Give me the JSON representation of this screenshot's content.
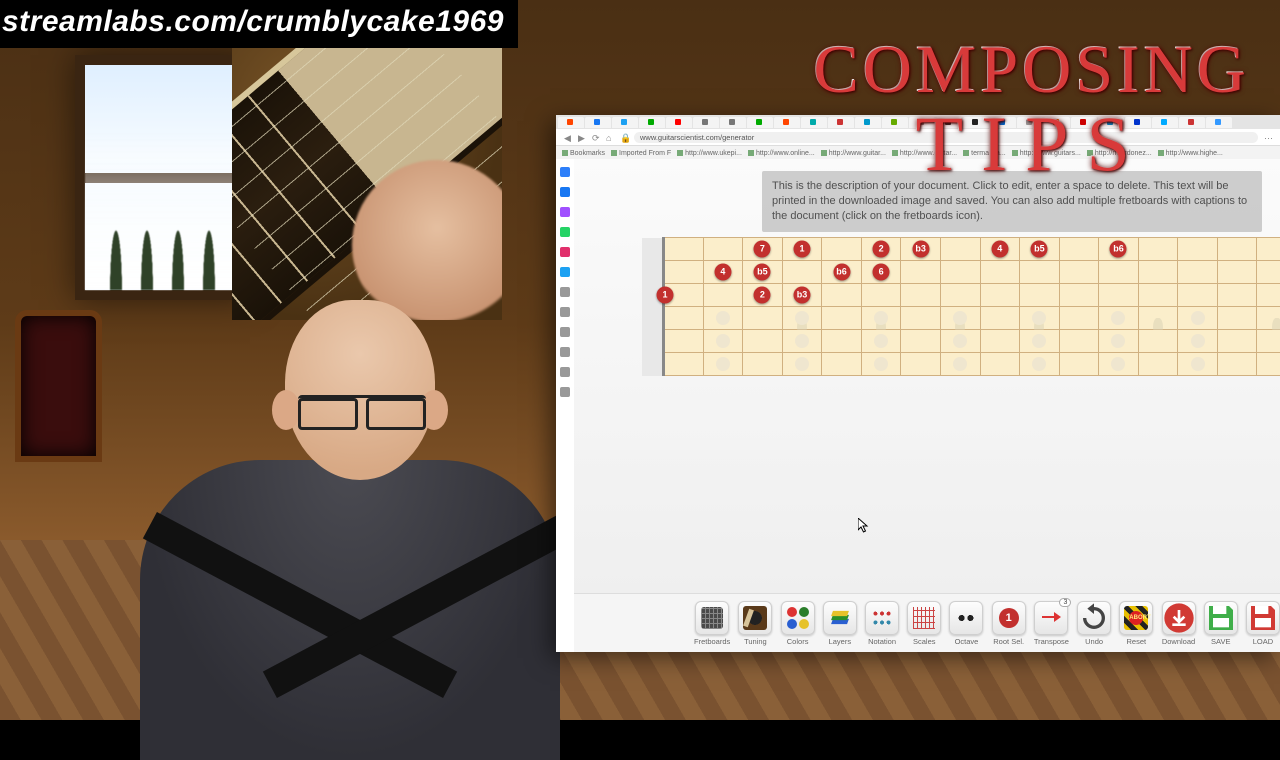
{
  "watermark": "streamlabs.com/crumblycake1969",
  "title": {
    "line1": "COMPOSING",
    "line2": "TIPS"
  },
  "browser": {
    "url": "www.guitarscientist.com/generator",
    "url_lock_icon": "lock-icon",
    "tabs": [
      {
        "fav": "#ff4500"
      },
      {
        "fav": "#1877f2"
      },
      {
        "fav": "#1da1f2"
      },
      {
        "fav": "#0a0"
      },
      {
        "fav": "#ff0000"
      },
      {
        "fav": "#777"
      },
      {
        "fav": "#777"
      },
      {
        "fav": "#0a0"
      },
      {
        "fav": "#ff4500"
      },
      {
        "fav": "#0aa"
      },
      {
        "fav": "#c33"
      },
      {
        "fav": "#09c"
      },
      {
        "fav": "#6a0"
      },
      {
        "fav": "#888"
      },
      {
        "fav": "#333"
      },
      {
        "fav": "#222"
      },
      {
        "fav": "#06c"
      },
      {
        "fav": "#999"
      },
      {
        "fav": "#e60"
      },
      {
        "fav": "#c00"
      },
      {
        "fav": "#08c"
      },
      {
        "fav": "#03c"
      },
      {
        "fav": "#0af"
      },
      {
        "fav": "#c33"
      },
      {
        "fav": "#39f"
      }
    ],
    "bookmarks": [
      "Bookmarks",
      "Imported From F",
      "http://www.ukepi...",
      "http://www.online...",
      "http://www.guitar...",
      "http://www.guitar...",
      "termalgia...",
      "http://www.guitars...",
      "http://mrordonez...",
      "http://www.highe..."
    ],
    "sidebar_icons": [
      {
        "name": "home-icon",
        "color": "#2d7ff9"
      },
      {
        "name": "facebook-icon",
        "color": "#1877f2"
      },
      {
        "name": "messenger-icon",
        "color": "#a050ff"
      },
      {
        "name": "whatsapp-icon",
        "color": "#25d366"
      },
      {
        "name": "instagram-icon",
        "color": "#e1306c"
      },
      {
        "name": "twitter-icon",
        "color": "#1da1f2"
      },
      {
        "name": "circle-icon",
        "color": "#999"
      },
      {
        "name": "play-icon",
        "color": "#999"
      },
      {
        "name": "heart-icon",
        "color": "#999"
      },
      {
        "name": "clock-icon",
        "color": "#999"
      },
      {
        "name": "gear-icon",
        "color": "#999"
      },
      {
        "name": "bulb-icon",
        "color": "#999"
      }
    ]
  },
  "description": "This is the description of your document. Click to edit, enter a space to delete. This text will be printed in the downloaded image and saved. You can also add multiple fretboards with captions to the document (click on the fretboards icon).",
  "fretboard": {
    "strings": 6,
    "frets": 15,
    "inlay_frets": [
      3,
      5,
      7,
      9,
      12,
      15
    ],
    "marks": [
      {
        "string": 1,
        "fret": 2,
        "label": "7"
      },
      {
        "string": 1,
        "fret": 3,
        "label": "1"
      },
      {
        "string": 1,
        "fret": 5,
        "label": "2"
      },
      {
        "string": 1,
        "fret": 6,
        "label": "b3"
      },
      {
        "string": 1,
        "fret": 8,
        "label": "4"
      },
      {
        "string": 1,
        "fret": 9,
        "label": "b5"
      },
      {
        "string": 1,
        "fret": 11,
        "label": "b6"
      },
      {
        "string": 2,
        "fret": 1,
        "label": "4"
      },
      {
        "string": 2,
        "fret": 2,
        "label": "b5"
      },
      {
        "string": 2,
        "fret": 4,
        "label": "b6"
      },
      {
        "string": 2,
        "fret": 5,
        "label": "6"
      },
      {
        "string": 3,
        "fret": 0,
        "label": "1"
      },
      {
        "string": 3,
        "fret": 2,
        "label": "2"
      },
      {
        "string": 3,
        "fret": 3,
        "label": "b3"
      }
    ]
  },
  "toolbar": [
    {
      "id": "fretboards",
      "label": "Fretboards"
    },
    {
      "id": "tuning",
      "label": "Tuning"
    },
    {
      "id": "colors",
      "label": "Colors"
    },
    {
      "id": "layers",
      "label": "Layers"
    },
    {
      "id": "notation",
      "label": "Notation"
    },
    {
      "id": "scales",
      "label": "Scales"
    },
    {
      "id": "octave",
      "label": "Octave"
    },
    {
      "id": "rootsel",
      "label": "Root Sel."
    },
    {
      "id": "transpose",
      "label": "Transpose",
      "badge": "3"
    },
    {
      "id": "undo",
      "label": "Undo"
    },
    {
      "id": "reset",
      "label": "Reset"
    },
    {
      "id": "download",
      "label": "Download"
    },
    {
      "id": "save",
      "label": "SAVE"
    },
    {
      "id": "load",
      "label": "LOAD"
    }
  ],
  "colors": {
    "mark_bg": "#c2302e",
    "mark_fg": "#ffffff",
    "save_green": "#3fae49",
    "download_red": "#d13a34",
    "load_red": "#d13a34"
  }
}
